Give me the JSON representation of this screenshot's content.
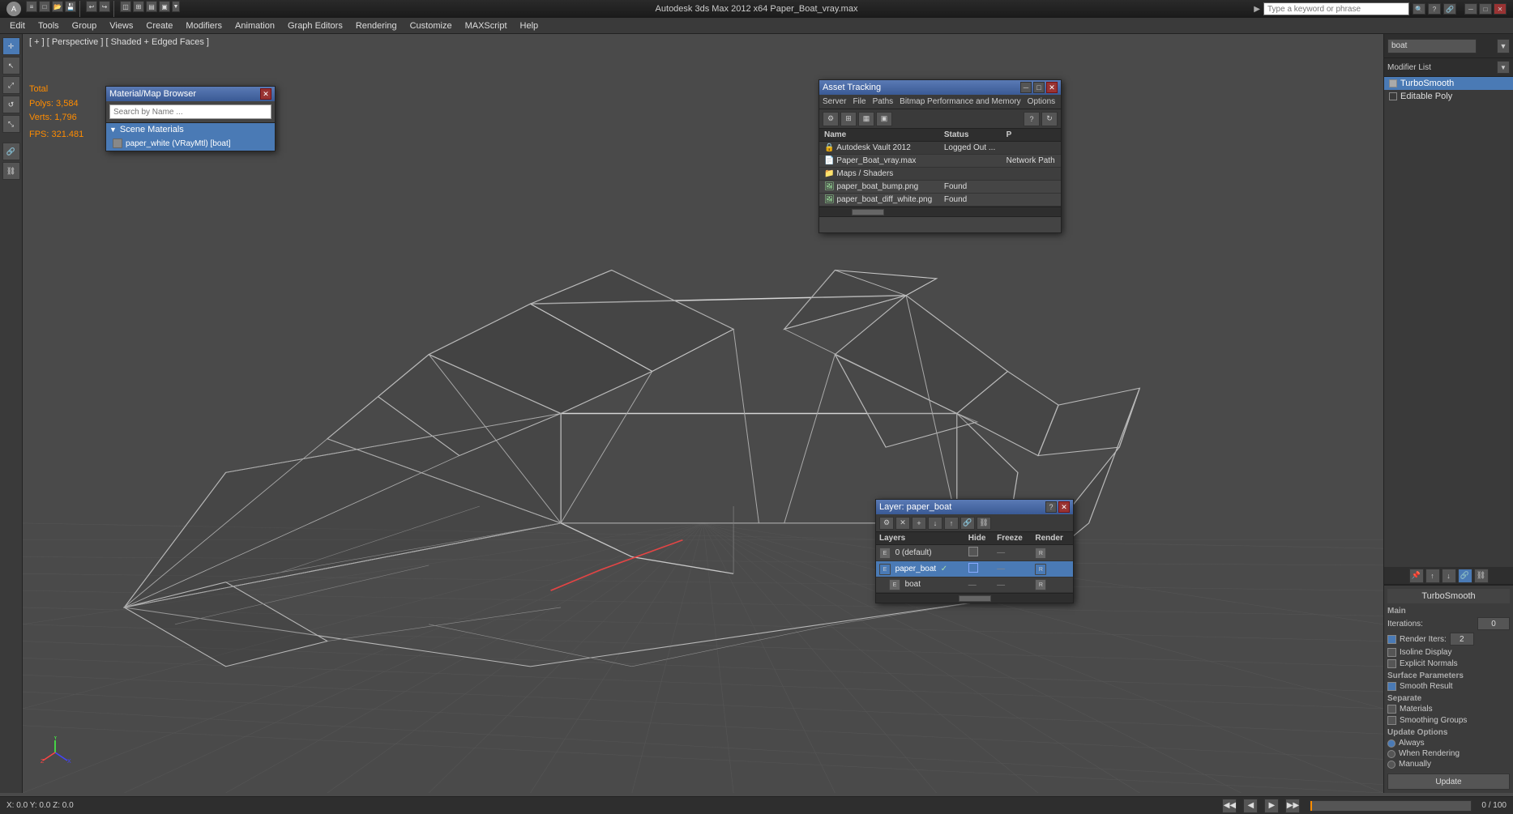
{
  "titlebar": {
    "title": "Autodesk 3ds Max 2012 x64    Paper_Boat_vray.max",
    "search_placeholder": "Type a keyword or phrase",
    "min_label": "─",
    "max_label": "□",
    "close_label": "✕",
    "logo": "A"
  },
  "menubar": {
    "items": [
      {
        "label": "[+]"
      },
      {
        "label": "[Perspective]"
      },
      {
        "label": "[Shaded + Edged Faces]"
      }
    ],
    "menus": [
      {
        "label": "Edit"
      },
      {
        "label": "Tools"
      },
      {
        "label": "Group"
      },
      {
        "label": "Views"
      },
      {
        "label": "Create"
      },
      {
        "label": "Modifiers"
      },
      {
        "label": "Animation"
      },
      {
        "label": "Graph Editors"
      },
      {
        "label": "Rendering"
      },
      {
        "label": "Customize"
      },
      {
        "label": "MAXScript"
      },
      {
        "label": "Help"
      }
    ]
  },
  "viewport": {
    "label": "[ + ] [ Perspective ] [ Shaded + Edged Faces ]",
    "stats": {
      "total_label": "Total",
      "polys_label": "Polys:",
      "polys_value": "3,584",
      "verts_label": "Verts:",
      "verts_value": "1,796"
    },
    "fps_label": "FPS:",
    "fps_value": "321.481"
  },
  "material_browser": {
    "title": "Material/Map Browser",
    "close_label": "✕",
    "search_placeholder": "Search by Name ...",
    "section_label": "Scene Materials",
    "items": [
      {
        "label": "paper_white (VRayMtl) [boat]",
        "selected": true
      }
    ]
  },
  "asset_tracking": {
    "title": "Asset Tracking",
    "close_label": "✕",
    "menus": [
      "Server",
      "File",
      "Paths",
      "Bitmap Performance and Memory",
      "Options"
    ],
    "columns": [
      "Name",
      "Status",
      "P"
    ],
    "rows": [
      {
        "indent": 0,
        "icon": "vault",
        "name": "Autodesk Vault 2012",
        "status": "Logged Out ...",
        "path": ""
      },
      {
        "indent": 1,
        "icon": "file",
        "name": "Paper_Boat_vray.max",
        "status": "",
        "path": "Network Path"
      },
      {
        "indent": 2,
        "icon": "folder",
        "name": "Maps / Shaders",
        "status": "",
        "path": ""
      },
      {
        "indent": 3,
        "icon": "image",
        "name": "paper_boat_bump.png",
        "status": "Found",
        "path": ""
      },
      {
        "indent": 3,
        "icon": "image",
        "name": "paper_boat_diff_white.png",
        "status": "Found",
        "path": ""
      }
    ]
  },
  "layer_panel": {
    "title": "Layer: paper_boat",
    "close_label": "✕",
    "columns": {
      "name": "Layers",
      "hide": "Hide",
      "freeze": "Freeze",
      "render": "Render"
    },
    "rows": [
      {
        "name": "0 (default)",
        "active": false,
        "checked": false,
        "selected": false
      },
      {
        "name": "paper_boat",
        "active": true,
        "checked": true,
        "selected": true
      },
      {
        "name": "boat",
        "active": false,
        "checked": false,
        "selected": false
      }
    ]
  },
  "modifier_panel": {
    "search_placeholder": "boat",
    "list_label": "Modifier List",
    "modifiers": [
      {
        "name": "TurboSmooth",
        "checked": true,
        "selected": true
      },
      {
        "name": "Editable Poly",
        "checked": false,
        "selected": false
      }
    ],
    "turbosm": {
      "title": "TurboSmooth",
      "main_label": "Main",
      "iterations_label": "Iterations:",
      "iterations_value": "0",
      "render_iters_label": "Render Iters:",
      "render_iters_value": "2",
      "isoline_label": "Isoline Display",
      "explicit_label": "Explicit Normals",
      "surface_label": "Surface Parameters",
      "smooth_label": "Smooth Result",
      "separate_label": "Separate",
      "materials_label": "Materials",
      "smoothing_label": "Smoothing Groups",
      "update_label": "Update Options",
      "always_label": "Always",
      "when_render_label": "When Rendering",
      "manually_label": "Manually",
      "update_btn": "Update"
    }
  },
  "icons": {
    "arrow_right": "▶",
    "arrow_down": "▼",
    "arrow_left": "◀",
    "check": "✓",
    "bullet": "●",
    "folder": "📁",
    "file": "📄",
    "image": "🖼",
    "vault": "🔒",
    "add": "+",
    "delete": "✕",
    "lock": "🔒",
    "eye": "👁",
    "refresh": "↻",
    "settings": "⚙",
    "pin": "📌",
    "move": "↕",
    "link": "🔗",
    "unlink": "⛓"
  }
}
